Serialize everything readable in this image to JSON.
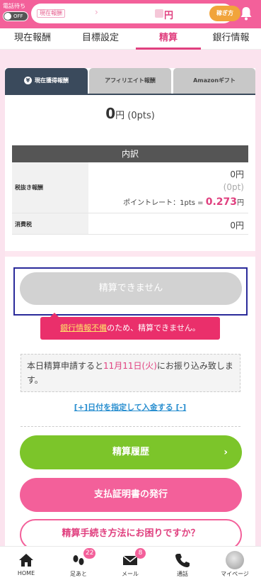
{
  "header": {
    "tel_status": "電話待ち",
    "toggle_label": "OFF",
    "earnings_label": "現在報酬",
    "earnings_suffix": "円",
    "how_to_button": "稼ぎ方"
  },
  "tabs": [
    "現在報酬",
    "目標設定",
    "精算",
    "銀行情報"
  ],
  "subtabs": [
    "現在獲得報酬",
    "アフィリエイト報酬",
    "Amazonギフト"
  ],
  "total": {
    "amount": "0",
    "unit": "円",
    "pts": "(0pts)"
  },
  "breakdown": {
    "heading": "内訳",
    "row1_label": "税抜き報酬",
    "row1_yen": "0円",
    "row1_pt": "(0pt)",
    "rate_label": "ポイントレート：1pts = ",
    "rate_value": "0.273",
    "rate_unit": "円",
    "row2_label": "消費税",
    "row2_yen": "0円"
  },
  "disabled_button": "精算できません",
  "error": {
    "link": "銀行情報不備",
    "rest": "のため、精算できません。"
  },
  "notice": {
    "prefix": "本日精算申請すると",
    "date": "11月11日(火)",
    "suffix": "にお振り込み致します。"
  },
  "date_link": "[+]日付を指定して入金する [-]",
  "buttons": {
    "history": "精算履歴",
    "certificate": "支払証明書の発行",
    "help": "精算手続き方法にお困りですか？"
  },
  "bottom_nav": [
    {
      "label": "HOME",
      "badge": ""
    },
    {
      "label": "足あと",
      "badge": "22"
    },
    {
      "label": "メール",
      "badge": "8"
    },
    {
      "label": "通話",
      "badge": ""
    },
    {
      "label": "マイページ",
      "badge": ""
    }
  ],
  "colors": {
    "brand_pink": "#f3609a",
    "accent_pink": "#e0407f",
    "green": "#7cc52a",
    "dark_tab": "#3a4a5c",
    "error_red": "#ea2f6b",
    "focus_border": "#2a2a9a"
  },
  "icons": [
    "bell-icon",
    "yen-icon",
    "chevron-right-icon",
    "home-icon",
    "footprints-icon",
    "mail-icon",
    "phone-icon",
    "avatar"
  ]
}
